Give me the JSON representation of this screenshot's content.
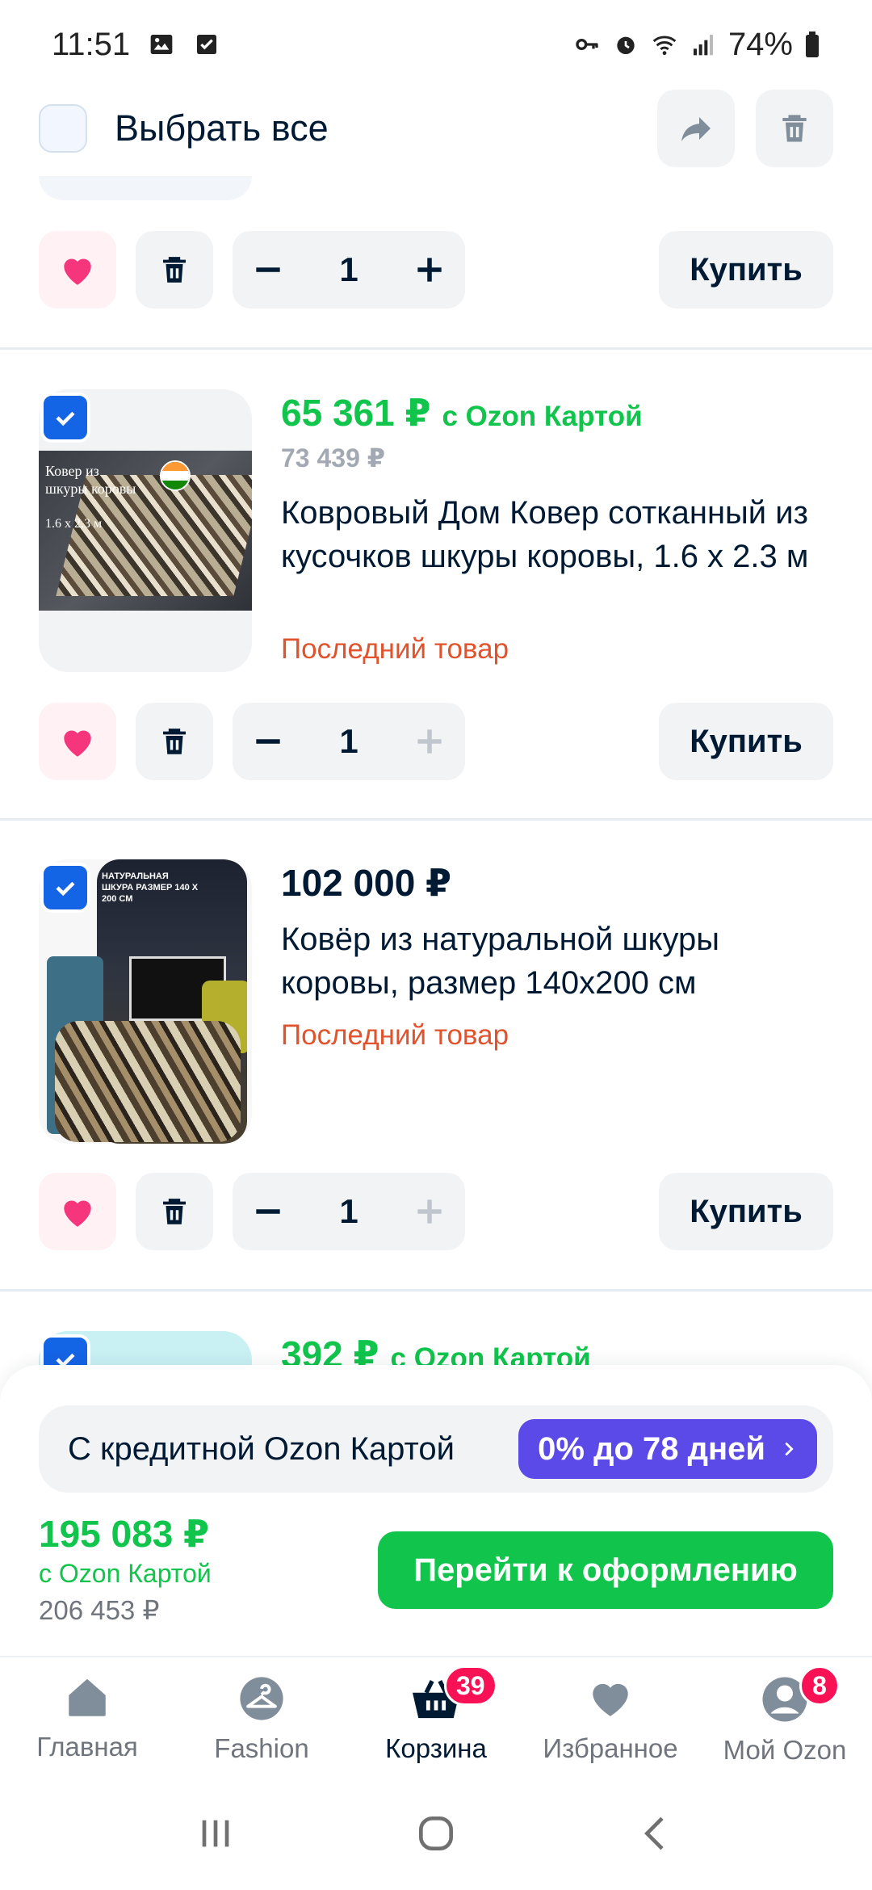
{
  "status_bar": {
    "time": "11:51",
    "battery": "74%"
  },
  "header": {
    "select_all_label": "Выбрать все"
  },
  "colors": {
    "green": "#10c44c",
    "blue": "#1464e6",
    "purple": "#5b4ae8",
    "red": "#e0532c",
    "pink": "#f91155",
    "dark": "#001a34"
  },
  "items": [
    {
      "quantity": "1",
      "buy_label": "Купить",
      "favorited": true
    },
    {
      "price": "65 361 ₽",
      "card_suffix": "с Ozon Картой",
      "old_price": "73 439 ₽",
      "title": "Ковровый Дом Ковер сотканный из кусочков шкуры коровы, 1.6 x 2.3 м",
      "stock_note": "Последний товар",
      "image_text": "Ковер из шкуры коровы",
      "image_size": "1.6 x 2.3 м",
      "quantity": "1",
      "buy_label": "Купить",
      "checked": true,
      "favorited": true
    },
    {
      "price": "102 000 ₽",
      "title": "Ковёр из натуральной шкуры коровы, размер 140х200 см",
      "stock_note": "Последний товар",
      "image_text": "НАТУРАЛЬНАЯ ШКУРА РАЗМЕР 140 X 200 СМ",
      "quantity": "1",
      "buy_label": "Купить",
      "checked": true,
      "favorited": true
    },
    {
      "price": "392 ₽",
      "card_suffix": "с Ozon Картой",
      "checked": true
    }
  ],
  "summary": {
    "credit_text": "С кредитной Ozon Картой",
    "credit_offer": "0% до 78 дней",
    "total_price": "195 083 ₽",
    "total_suffix": "с Ozon Картой",
    "total_old": "206 453 ₽",
    "checkout_label": "Перейти к оформлению"
  },
  "tabs": [
    {
      "label": "Главная",
      "icon": "home-icon"
    },
    {
      "label": "Fashion",
      "icon": "hanger-icon"
    },
    {
      "label": "Корзина",
      "icon": "basket-icon",
      "badge": "39",
      "active": true
    },
    {
      "label": "Избранное",
      "icon": "heart-icon"
    },
    {
      "label": "Мой Ozon",
      "icon": "user-icon",
      "badge": "8"
    }
  ]
}
